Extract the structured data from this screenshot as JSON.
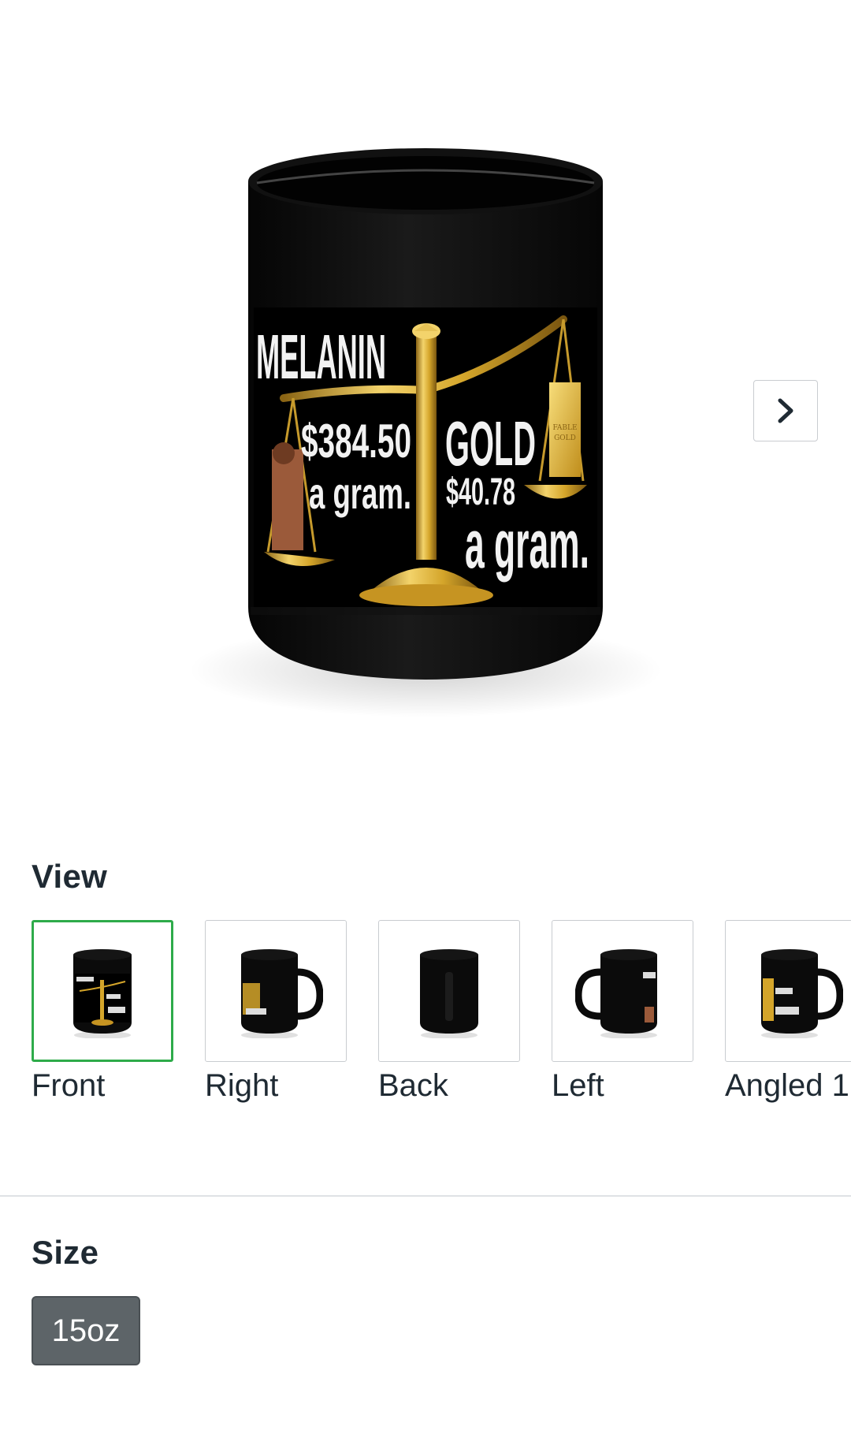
{
  "product_image": {
    "alt": "Black mug front view",
    "print_text": {
      "melanin": "MELANIN",
      "melanin_price": "$384.50",
      "melanin_unit": "a gram.",
      "gold": "GOLD",
      "gold_price": "$40.78",
      "gold_unit": "a gram.",
      "bar_text_1": "FABLE",
      "bar_text_2": "GOLD"
    },
    "next_icon": "chevron-right-icon"
  },
  "view": {
    "title": "View",
    "options": [
      {
        "label": "Front",
        "selected": true
      },
      {
        "label": "Right",
        "selected": false
      },
      {
        "label": "Back",
        "selected": false
      },
      {
        "label": "Left",
        "selected": false
      },
      {
        "label": "Angled 1",
        "selected": false
      }
    ]
  },
  "size": {
    "title": "Size",
    "options": [
      {
        "label": "15oz",
        "selected": true
      }
    ]
  },
  "colors": {
    "accent_selected": "#2eab4a",
    "size_selected_bg": "#5d6468",
    "mug": "#0c0c0c",
    "gold": "#d4a52a"
  }
}
